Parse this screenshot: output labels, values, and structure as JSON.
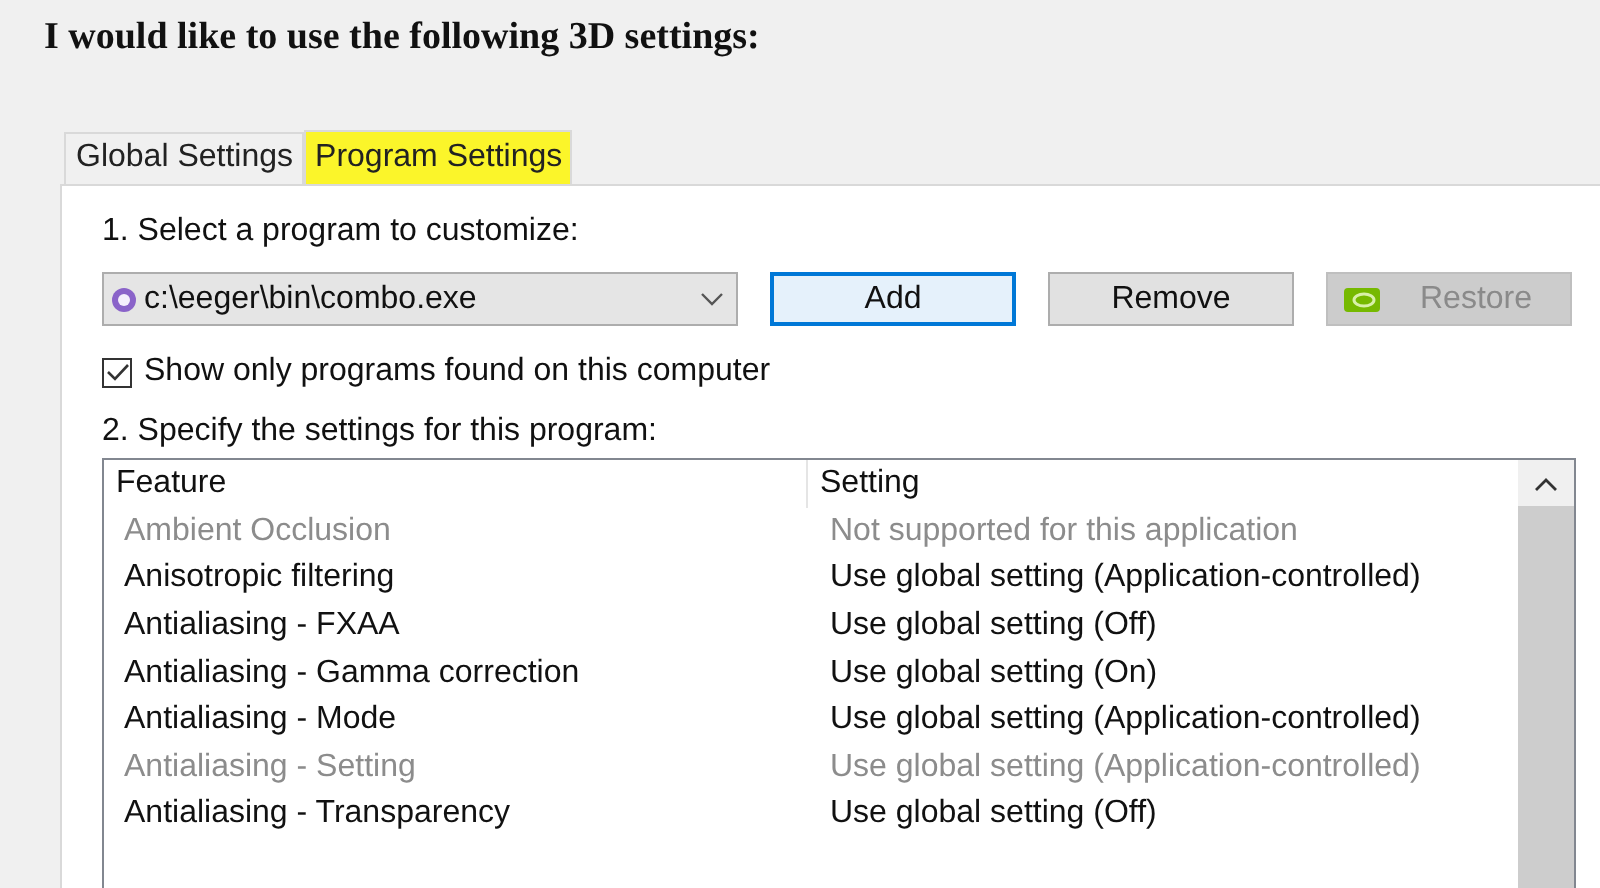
{
  "heading": "I would like to use the following 3D settings:",
  "tabs": [
    {
      "label": "Global Settings",
      "selected": false,
      "highlighted": false
    },
    {
      "label": "Program Settings",
      "selected": true,
      "highlighted": true
    }
  ],
  "step1": "1. Select a program to customize:",
  "program_select": {
    "value": "c:\\eeger\\bin\\combo.exe"
  },
  "buttons": [
    {
      "label": "Add",
      "focused": true,
      "disabled": false,
      "icon": false
    },
    {
      "label": "Remove",
      "focused": false,
      "disabled": false,
      "icon": false
    },
    {
      "label": "Restore",
      "focused": false,
      "disabled": true,
      "icon": true
    }
  ],
  "show_only_checkbox": {
    "label": "Show only programs found on this computer",
    "checked": true
  },
  "step2": "2. Specify the settings for this program:",
  "table": {
    "columns": [
      "Feature",
      "Setting"
    ],
    "rows": [
      {
        "feature": "Ambient Occlusion",
        "setting": "Not supported for this application",
        "disabled": true
      },
      {
        "feature": "Anisotropic filtering",
        "setting": "Use global setting (Application-controlled)",
        "disabled": false
      },
      {
        "feature": "Antialiasing - FXAA",
        "setting": "Use global setting (Off)",
        "disabled": false
      },
      {
        "feature": "Antialiasing - Gamma correction",
        "setting": "Use global setting (On)",
        "disabled": false
      },
      {
        "feature": "Antialiasing - Mode",
        "setting": "Use global setting (Application-controlled)",
        "disabled": false
      },
      {
        "feature": "Antialiasing - Setting",
        "setting": "Use global setting (Application-controlled)",
        "disabled": true
      },
      {
        "feature": "Antialiasing - Transparency",
        "setting": "Use global setting (Off)",
        "disabled": false
      }
    ]
  }
}
